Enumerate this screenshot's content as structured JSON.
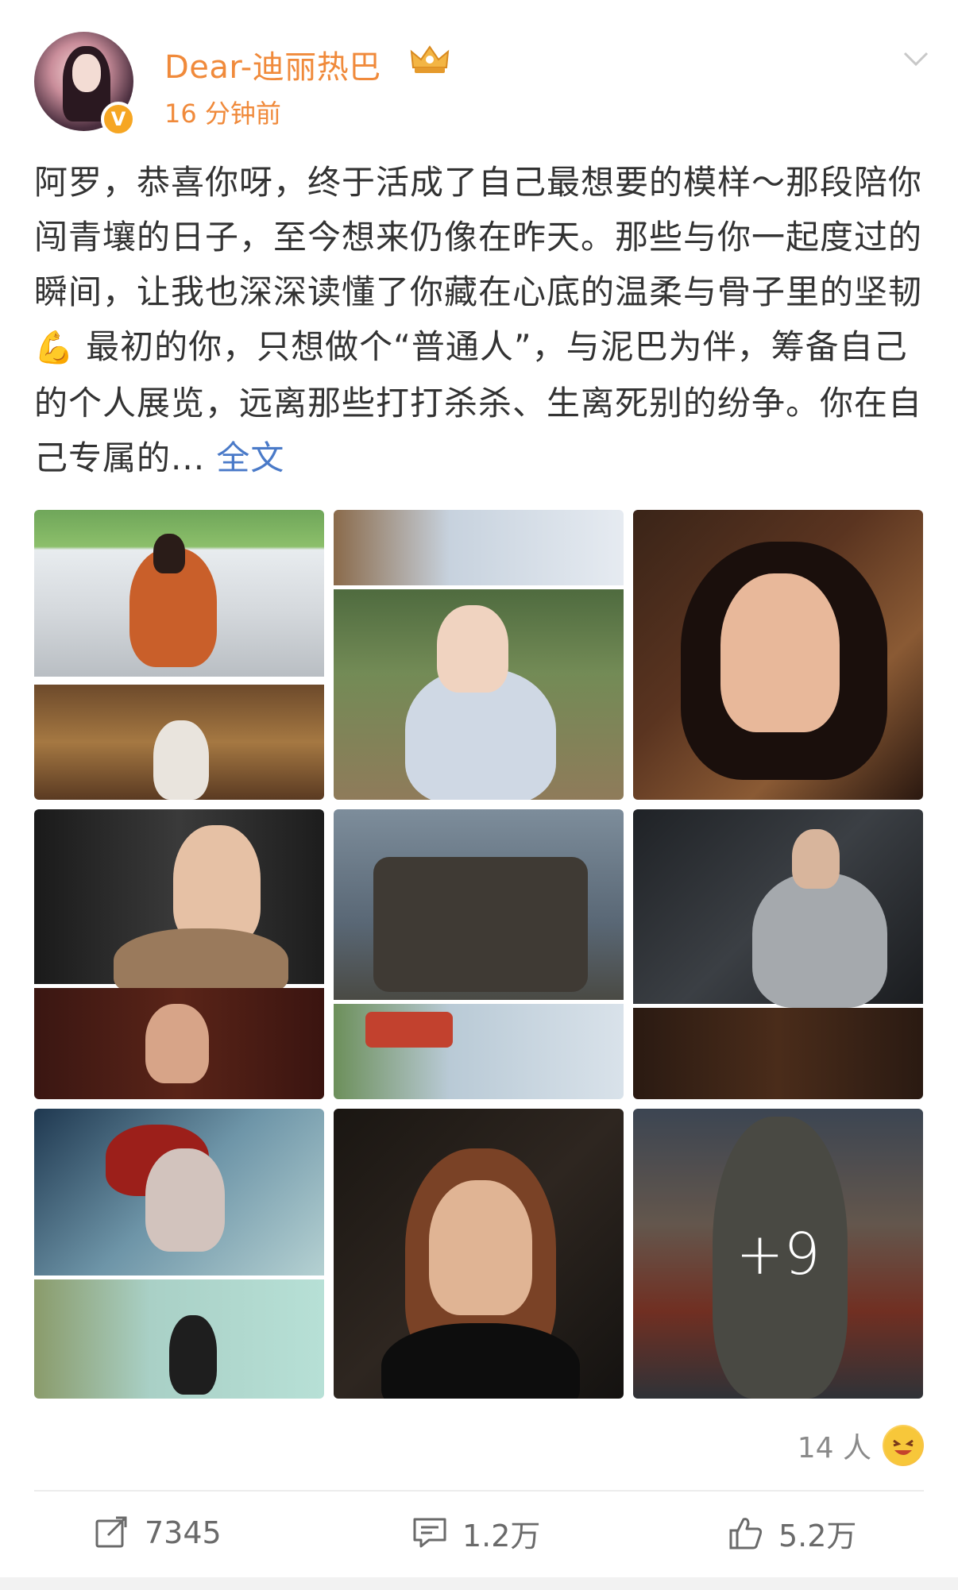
{
  "post": {
    "author": "Dear-迪丽热巴",
    "time": "16 分钟前",
    "verified": "V",
    "text_before_emoji": "阿罗，恭喜你呀，终于活成了自己最想要的模样～那段陪你闯青壤的日子，至今想来仍像在昨天。那些与你一起度过的瞬间，让我也深深读懂了你藏在心底的温柔与骨子里的坚韧",
    "emoji": "💪",
    "text_after_emoji": " 最初的你，只想做个“普通人”，与泥巴为伴，筹备自己的个人展览，远离那些打打杀杀、生离死别的纷争。你在自己专属的... ",
    "full_text_link": "全文",
    "more_images": "+9"
  },
  "reactions": {
    "count": "14 人"
  },
  "actions": {
    "repost": "7345",
    "comment": "1.2万",
    "like": "5.2万"
  },
  "icons": {
    "crown": "crown-icon",
    "chevron": "chevron-down-icon",
    "repost": "share-icon",
    "comment": "comment-icon",
    "like": "thumbs-up-icon"
  },
  "colors": {
    "accent": "#f08a3b",
    "link": "#4a7ac8",
    "text": "#333333",
    "muted": "#8a8a8a"
  }
}
